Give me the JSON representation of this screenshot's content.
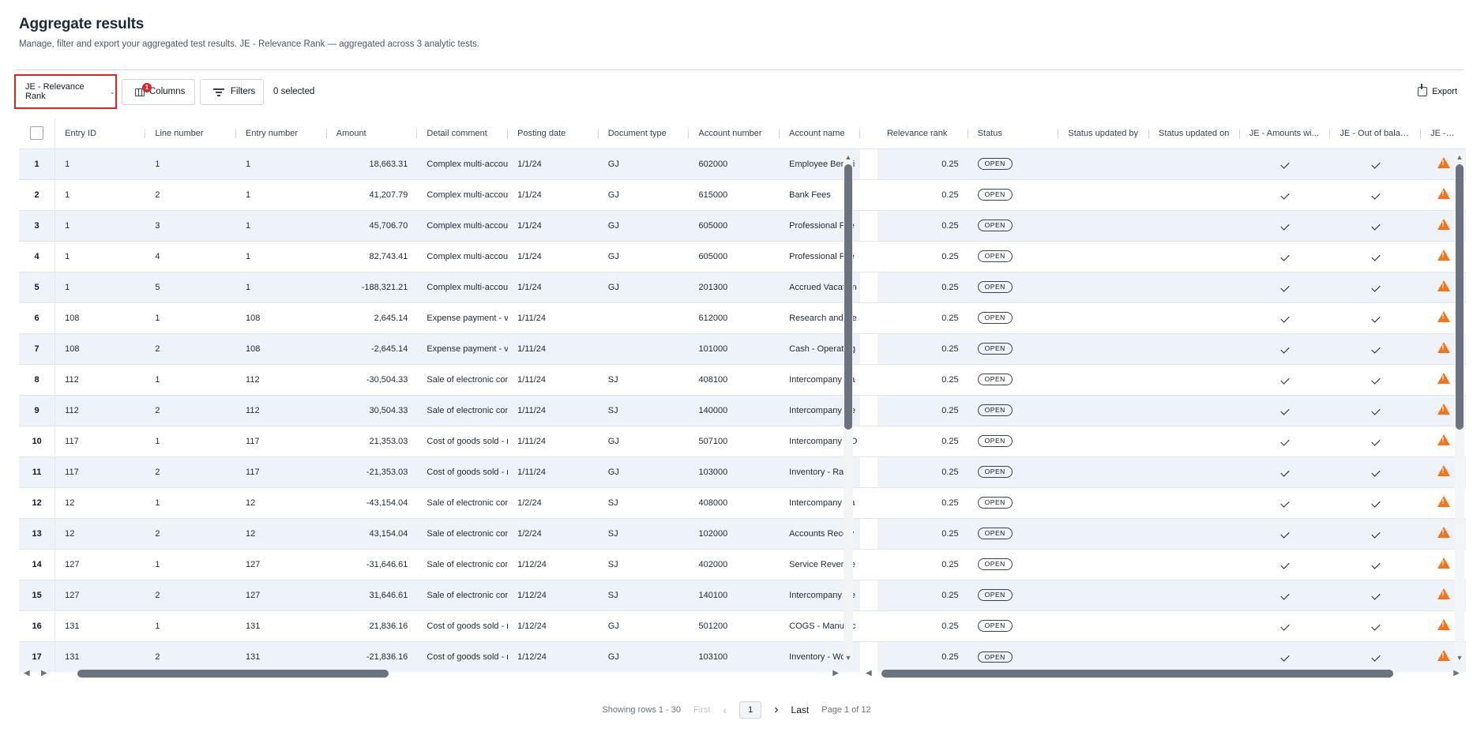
{
  "header": {
    "title": "Aggregate results",
    "subtitle": "Manage, filter and export your aggregated test results. JE - Relevance Rank — aggregated across 3 analytic tests."
  },
  "toolbar": {
    "view_select": "JE - Relevance Rank",
    "columns_label": "Columns",
    "columns_badge": "1",
    "filters_label": "Filters",
    "selected_count": "0 selected",
    "export_label": "Export"
  },
  "columns": [
    "Entry ID",
    "Line number",
    "Entry number",
    "Amount",
    "Detail comment",
    "Posting date",
    "Document type",
    "Account number",
    "Account name",
    "Relevance rank",
    "Status",
    "Status updated by",
    "Status updated on",
    "JE - Amounts wi...",
    "JE - Out of balan...",
    "JE - Key Users"
  ],
  "rows": [
    {
      "n": "1",
      "entry_id": "1",
      "line": "1",
      "entry_no": "1",
      "amount": "18,663.31",
      "comment": "Complex multi-accou",
      "date": "1/1/24",
      "doc": "GJ",
      "acct": "602000",
      "acct_name": "Employee Benefi",
      "rank": "0.25",
      "status": "OPEN"
    },
    {
      "n": "2",
      "entry_id": "1",
      "line": "2",
      "entry_no": "1",
      "amount": "41,207.79",
      "comment": "Complex multi-accou",
      "date": "1/1/24",
      "doc": "GJ",
      "acct": "615000",
      "acct_name": "Bank Fees",
      "rank": "0.25",
      "status": "OPEN"
    },
    {
      "n": "3",
      "entry_id": "1",
      "line": "3",
      "entry_no": "1",
      "amount": "45,706.70",
      "comment": "Complex multi-accou",
      "date": "1/1/24",
      "doc": "GJ",
      "acct": "605000",
      "acct_name": "Professional Fee",
      "rank": "0.25",
      "status": "OPEN"
    },
    {
      "n": "4",
      "entry_id": "1",
      "line": "4",
      "entry_no": "1",
      "amount": "82,743.41",
      "comment": "Complex multi-accou",
      "date": "1/1/24",
      "doc": "GJ",
      "acct": "605000",
      "acct_name": "Professional Fee",
      "rank": "0.25",
      "status": "OPEN"
    },
    {
      "n": "5",
      "entry_id": "1",
      "line": "5",
      "entry_no": "1",
      "amount": "-188,321.21",
      "comment": "Complex multi-accou",
      "date": "1/1/24",
      "doc": "GJ",
      "acct": "201300",
      "acct_name": "Accrued Vacation",
      "rank": "0.25",
      "status": "OPEN"
    },
    {
      "n": "6",
      "entry_id": "108",
      "line": "1",
      "entry_no": "108",
      "amount": "2,645.14",
      "comment": "Expense payment - ve",
      "date": "1/11/24",
      "doc": "",
      "acct": "612000",
      "acct_name": "Research and De",
      "rank": "0.25",
      "status": "OPEN"
    },
    {
      "n": "7",
      "entry_id": "108",
      "line": "2",
      "entry_no": "108",
      "amount": "-2,645.14",
      "comment": "Expense payment - ve",
      "date": "1/11/24",
      "doc": "",
      "acct": "101000",
      "acct_name": "Cash - Operating",
      "rank": "0.25",
      "status": "OPEN"
    },
    {
      "n": "8",
      "entry_id": "112",
      "line": "1",
      "entry_no": "112",
      "amount": "-30,504.33",
      "comment": "Sale of electronic con",
      "date": "1/11/24",
      "doc": "SJ",
      "acct": "408100",
      "acct_name": "Intercompany Sa",
      "rank": "0.25",
      "status": "OPEN"
    },
    {
      "n": "9",
      "entry_id": "112",
      "line": "2",
      "entry_no": "112",
      "amount": "30,504.33",
      "comment": "Sale of electronic con",
      "date": "1/11/24",
      "doc": "SJ",
      "acct": "140000",
      "acct_name": "Intercompany Re",
      "rank": "0.25",
      "status": "OPEN"
    },
    {
      "n": "10",
      "entry_id": "117",
      "line": "1",
      "entry_no": "117",
      "amount": "21,353.03",
      "comment": "Cost of goods sold - r",
      "date": "1/11/24",
      "doc": "GJ",
      "acct": "507100",
      "acct_name": "Intercompany CO",
      "rank": "0.25",
      "status": "OPEN"
    },
    {
      "n": "11",
      "entry_id": "117",
      "line": "2",
      "entry_no": "117",
      "amount": "-21,353.03",
      "comment": "Cost of goods sold - r",
      "date": "1/11/24",
      "doc": "GJ",
      "acct": "103000",
      "acct_name": "Inventory - Raw",
      "rank": "0.25",
      "status": "OPEN"
    },
    {
      "n": "12",
      "entry_id": "12",
      "line": "1",
      "entry_no": "12",
      "amount": "-43,154.04",
      "comment": "Sale of electronic con",
      "date": "1/2/24",
      "doc": "SJ",
      "acct": "408000",
      "acct_name": "Intercompany Sa",
      "rank": "0.25",
      "status": "OPEN"
    },
    {
      "n": "13",
      "entry_id": "12",
      "line": "2",
      "entry_no": "12",
      "amount": "43,154.04",
      "comment": "Sale of electronic con",
      "date": "1/2/24",
      "doc": "SJ",
      "acct": "102000",
      "acct_name": "Accounts Receiv",
      "rank": "0.25",
      "status": "OPEN"
    },
    {
      "n": "14",
      "entry_id": "127",
      "line": "1",
      "entry_no": "127",
      "amount": "-31,646.61",
      "comment": "Sale of electronic con",
      "date": "1/12/24",
      "doc": "SJ",
      "acct": "402000",
      "acct_name": "Service Revenue",
      "rank": "0.25",
      "status": "OPEN"
    },
    {
      "n": "15",
      "entry_id": "127",
      "line": "2",
      "entry_no": "127",
      "amount": "31,646.61",
      "comment": "Sale of electronic con",
      "date": "1/12/24",
      "doc": "SJ",
      "acct": "140100",
      "acct_name": "Intercompany Re",
      "rank": "0.25",
      "status": "OPEN"
    },
    {
      "n": "16",
      "entry_id": "131",
      "line": "1",
      "entry_no": "131",
      "amount": "21,836.16",
      "comment": "Cost of goods sold - r",
      "date": "1/12/24",
      "doc": "GJ",
      "acct": "501200",
      "acct_name": "COGS - Manufac",
      "rank": "0.25",
      "status": "OPEN"
    },
    {
      "n": "17",
      "entry_id": "131",
      "line": "2",
      "entry_no": "131",
      "amount": "-21,836.16",
      "comment": "Cost of goods sold - r",
      "date": "1/12/24",
      "doc": "GJ",
      "acct": "103100",
      "acct_name": "Inventory - Work",
      "rank": "0.25",
      "status": "OPEN"
    }
  ],
  "pagination": {
    "showing": "Showing rows 1 - 30",
    "first": "First",
    "current": "1",
    "last": "Last",
    "page_of": "Page 1 of 12"
  }
}
